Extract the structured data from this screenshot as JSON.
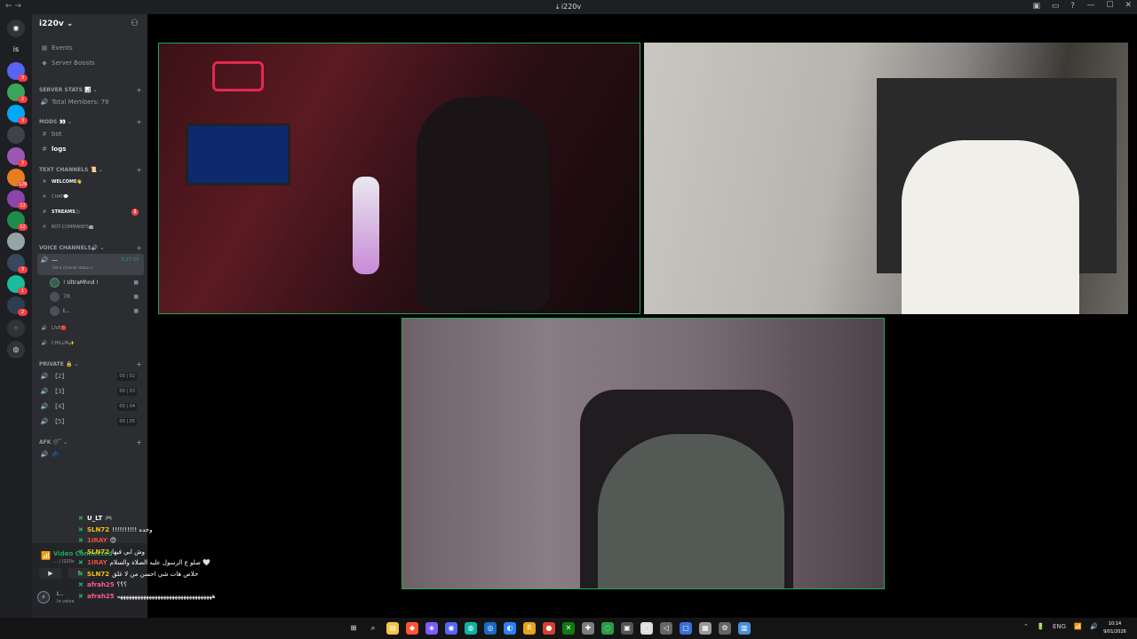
{
  "titlebar": {
    "nav": "← →",
    "title": "⤓ i220v",
    "icons": [
      "inbox-icon",
      "monitor-icon",
      "help-icon"
    ],
    "window_controls": [
      "—",
      "☐",
      "✕"
    ]
  },
  "rail": {
    "servers": [
      {
        "label": "is",
        "color": "#1e1f22"
      },
      {
        "label": "",
        "color": "#5865f2",
        "badge": "3"
      },
      {
        "label": "",
        "color": "#3ba55c",
        "badge": "2"
      },
      {
        "label": "",
        "color": "#00a8fc",
        "badge": "3"
      },
      {
        "label": "",
        "color": "#404249",
        "badge": ""
      },
      {
        "label": "",
        "color": "#9b59b6",
        "badge": "3"
      },
      {
        "label": "",
        "color": "#e67e22",
        "badge": "126"
      },
      {
        "label": "",
        "color": "#8e44ad",
        "badge": "12"
      },
      {
        "label": "",
        "color": "#1f8b4c",
        "badge": "12"
      },
      {
        "label": "",
        "color": "#95a5a6",
        "badge": ""
      },
      {
        "label": "",
        "color": "#34495e",
        "badge": "3"
      },
      {
        "label": "",
        "color": "#1abc9c",
        "badge": "1"
      },
      {
        "label": "",
        "color": "#2c3e50",
        "badge": "2"
      }
    ],
    "add_label": "+",
    "explore_label": "◎"
  },
  "sidebar": {
    "server_name": "i220v",
    "events": "Events",
    "boosts": "Server Boosts",
    "stats_cat": "SERVER STATS 📊",
    "total_members": "Total Members: 79",
    "mods_cat": "MODS 👀",
    "bot": "bot",
    "logs": "logs",
    "text_cat": "TEXT CHANNELS 📜",
    "welcome": "WELCOME👋",
    "chat": "CHAT💬",
    "streams": "STREAMS🎥",
    "streams_mention": "1",
    "botcmds": "BOT-COMMANDS🤖",
    "voice_cat": "VOICE CHANNELS🔊",
    "active_voice": "—",
    "active_voice_time": "5:27:33",
    "set_status": "Set a channel status ✏",
    "users": [
      "! UltraMhnd !",
      "7R",
      "I..."
    ],
    "live": "LIVE🔴",
    "chillin": "CHILLIN✨",
    "private_cat": "PRIVATE 🔒",
    "private_rooms": [
      {
        "name": "【2】",
        "count": "00 | 02"
      },
      {
        "name": "【3】",
        "count": "00 | 03"
      },
      {
        "name": "【4】",
        "count": "00 | 04"
      },
      {
        "name": "【5】",
        "count": "00 | 05"
      }
    ],
    "afk_cat": "AFK 😴",
    "afk_channel": "💤"
  },
  "voice_panel": {
    "title": "Video Connected",
    "subtitle": "… / i220v",
    "me_name": "I...",
    "me_status": "In voice"
  },
  "chat_overlay": [
    {
      "name": "U_LT",
      "color": "#ffffff",
      "text": "🎮"
    },
    {
      "name": "SLN72",
      "color": "#f1c40f",
      "text": "!!!!!!!!!! وحده"
    },
    {
      "name": "1IRAY",
      "color": "#e74c3c",
      "text": "😊"
    },
    {
      "name": "SLN72",
      "color": "#f1c40f",
      "text": "وش ابي فيها"
    },
    {
      "name": "1IRAY",
      "color": "#e74c3c",
      "text": "صلو ع الرسول عليه الصلاة والسلام 🤍"
    },
    {
      "name": "SLN72",
      "color": "#f1c40f",
      "text": "خلاص هات شي احسن من لا غلق"
    },
    {
      "name": "afrah25",
      "color": "#ff5c8a",
      "text": "؟؟؟"
    },
    {
      "name": "afrah25",
      "color": "#ff5c8a",
      "text": "هههههههههههههههههههههههههههههههههه"
    }
  ],
  "taskbar": {
    "icons": [
      "windows-icon",
      "search-icon",
      "explorer-icon",
      "brave-icon",
      "app-icon",
      "discord-icon",
      "app-icon",
      "steam-icon",
      "app-icon",
      "app-icon",
      "app-icon",
      "xbox-icon",
      "app-icon",
      "app-icon",
      "app-icon",
      "app-icon",
      "app-icon",
      "app-icon",
      "app-icon",
      "settings-icon",
      "app-icon"
    ],
    "tray": [
      "⌃",
      "🔋",
      "ENG",
      "📶",
      "🔊"
    ],
    "time": "10:14",
    "date": "9/01/2026"
  }
}
